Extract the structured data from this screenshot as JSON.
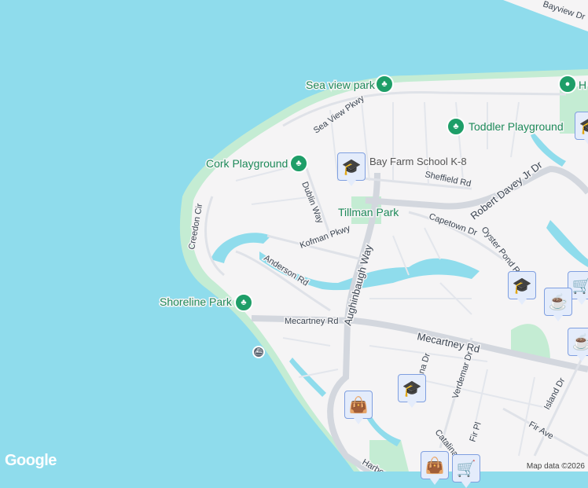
{
  "map": {
    "parks": [
      "Sea view park",
      "Toddler Playground",
      "Cork Playground",
      "Tillman Park",
      "Shoreline Park",
      "H"
    ],
    "schools": [
      "Bay Farm School K-8"
    ],
    "streets": [
      "Bayview Dr",
      "Sea View Pkwy",
      "Dublin Way",
      "Sheffield Rd",
      "Robert Davey Jr Dr",
      "Capetown Dr",
      "Oyster Pond Rd",
      "Kofman Pkwy",
      "Creedon Cir",
      "Anderson Rd",
      "Aughinbaugh Way",
      "Mecartney Rd",
      "Mecartney Rd",
      "Verdemar Dr",
      "Fir Pl",
      "Fir Ave",
      "Island Dr",
      "Catalina",
      "Harbor",
      "tana Dr"
    ],
    "colors": {
      "water": "#8fdcec",
      "land": "#f5f4f5",
      "park": "#c4ecd3",
      "marker": "#0d4a6b",
      "park_pin": "#1e9e68"
    }
  },
  "footer": {
    "logo": "Google",
    "attribution": "Map data ©2026"
  }
}
